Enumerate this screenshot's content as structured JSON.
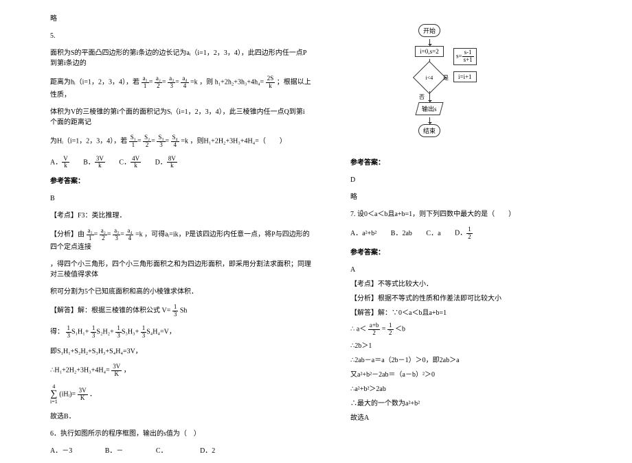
{
  "left": {
    "lue": "略",
    "q5_num": "5.",
    "q5_l1": "面积为S的平面凸四边形的第i条边的边长记为aᵢ（i=1，2，3，4），此四边形内任一点P到第i条边的",
    "q5_l2_pre": "距离为hᵢ（i=1，2，3，4），若",
    "q5_frac_a1n": "a₁",
    "q5_frac_a1d": "1",
    "q5_frac_a2n": "a₂",
    "q5_frac_a2d": "2",
    "q5_frac_a3n": "a₃",
    "q5_frac_a3d": "3",
    "q5_frac_a4n": "a₄",
    "q5_frac_a4d": "4",
    "q5_eqk": "=k",
    "q5_l2_mid": "，则",
    "q5_l2_sum": "h₁+2h₂+3h₃+4h₄=",
    "q5_frac_2sn": "2S",
    "q5_frac_2sd": "k",
    "q5_l2_post": "；根据以上性质，",
    "q5_l3": "体积为V的三棱锥的第i个面的面积记为Sᵢ（i=1，2，3，4），此三棱锥内任一点Q到第i个面的距离记",
    "q5_l4_pre": "为Hᵢ（i=1，2，3，4），若",
    "q5_frac_s1n": "S₁",
    "q5_frac_s1d": "1",
    "q5_frac_s2n": "S₂",
    "q5_frac_s2d": "2",
    "q5_frac_s3n": "S₃",
    "q5_frac_s3d": "3",
    "q5_frac_s4n": "S₄",
    "q5_frac_s4d": "4",
    "q5_l4_post": "，则H₁+2H₂+3H₃+4H₄=（　　）",
    "optA": "A．",
    "optAn": "V",
    "optAd": "k",
    "optB": "B．",
    "optBn": "3V",
    "optBd": "k",
    "optC": "C．",
    "optCn": "4V",
    "optCd": "k",
    "optD": "D．",
    "optDn": "8V",
    "optDd": "k",
    "ans_label": "参考答案：",
    "ans5": "B",
    "kd5": "【考点】F3：类比推理．",
    "fx5_pre": "【分析】由",
    "fx5_post": "，可得aᵢ=ik，P是该四边形内任意一点，将P与四边形的四个定点连接",
    "fx5_l2": "，得四个小三角形，四个小三角形面积之和为四边形面积，即采用分割法求面积；同理对三棱值得求体",
    "fx5_l3": "积可分割为5个已知底面积和高的小棱锥求体积．",
    "jd5_l1_pre": "【解答】解：根据三棱锥的体积公式",
    "jd5_vn": "V=",
    "jd5_v1": "1",
    "jd5_v3": "3",
    "jd5_sh": "Sh",
    "jd5_l2_pre": "得：",
    "jd5_s1n": "1",
    "jd5_s1d": "3",
    "jd5_terms": "S₁H₁+",
    "jd5_terms2": "S₂H₂+",
    "jd5_terms3": "S₃H₃+",
    "jd5_terms4": "S₄H₄=V，",
    "jd5_l3": "即S₁H₁+S₂H₂+S₃H₃+S₄H₄=3V，",
    "jd5_l4_pre": "∴H₁+2H₂+3H₃+4H₄=",
    "jd5_3vn": "3V",
    "jd5_3vd": "K",
    "jd5_comma": "，",
    "jd5_sig_top": "4",
    "jd5_sig_bot": "i=1",
    "jd5_sig_body": "(iHᵢ)=",
    "jd5_sig_rn": "3V",
    "jd5_sig_rd": "K",
    "jd5_sig_dot": "．",
    "jd5_end": "故选B．",
    "q6_l1": "6．执行如图所示的程序框图，输出的s值为（　）",
    "q6_opts_A": "A．－3",
    "q6_opts_B": "B．－",
    "q6_opts_C": "C．",
    "q6_opts_D": "D．2"
  },
  "right": {
    "flow_start": "开始",
    "flow_init": "i=0,s=2",
    "flow_cond": "i<4",
    "flow_yes": "是",
    "flow_no": "否",
    "flow_calc_n": "s-1",
    "flow_calc_d": "s+1",
    "flow_calc_pre": "s=",
    "flow_inc": "i=i+1",
    "flow_out": "输出s",
    "flow_end": "结束",
    "ans_label": "参考答案：",
    "ans6": "D",
    "lue": "略",
    "q7_l1": "7. 设0＜a＜b且a+b=1，则下列四数中最大的是（　　）",
    "q7_optA": "A．a²+b²",
    "q7_optB": "B．2ab",
    "q7_optC": "C．a",
    "q7_optD_pre": "D．",
    "q7_optD_n": "1",
    "q7_optD_d": "2",
    "ans7": "A",
    "kd7": "【考点】不等式比较大小．",
    "fx7": "【分析】根据不等式的性质和作差法即可比较大小",
    "jd7_l1": "【解答】解：∵0＜a＜b且a+b=1",
    "jd7_l2_pre": "∴",
    "jd7_l2_a": "a＜",
    "jd7_l2_n": "a+b",
    "jd7_l2_d": "2",
    "jd7_l2_eq": "=",
    "jd7_l2_1n": "1",
    "jd7_l2_1d": "2",
    "jd7_l2_post": "＜b",
    "jd7_l3": "∴2b＞1",
    "jd7_l4": "∴2ab－a＝a（2b－1）＞0，即2ab＞a",
    "jd7_l5": "又a²+b²－2ab＝（a－b）²＞0",
    "jd7_l6": "∴a²+b²＞2ab",
    "jd7_l7": "∴最大的一个数为a²+b²",
    "jd7_end": "故选A"
  }
}
